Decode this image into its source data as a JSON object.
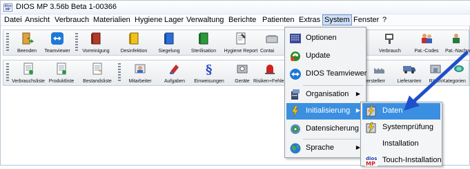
{
  "window": {
    "title": "DIOS MP 3.56b Beta 1-00366",
    "app_icon_text": "dios MP"
  },
  "menubar": {
    "items": [
      "Datei",
      "Ansicht",
      "Verbrauch",
      "Materialien",
      "Hygiene",
      "Lager",
      "Verwaltung",
      "Berichte",
      "Patienten",
      "Extras",
      "System",
      "Fenster",
      "?"
    ],
    "active": "System"
  },
  "toolbar1": {
    "buttons": [
      "Beenden",
      "Teamviewer",
      "Vorreinigung",
      "Desinfektion",
      "Siegelung",
      "Sterilisation",
      "Hygiene Report",
      "Contai",
      "Verbrauch",
      "Pat.-Codes",
      "Pat.-Nachw"
    ]
  },
  "toolbar2": {
    "buttons": [
      "Verbrauchsliste",
      "Produktliste",
      "Bestandsliste",
      "Mitarbeiter",
      "Aufgaben",
      "Einweisungen",
      "Geräte",
      "Risiken+Fehle",
      "erstellerr",
      "Lieferanten",
      "Räum",
      "Kategorien"
    ]
  },
  "system_menu": {
    "items": [
      {
        "label": "Optionen",
        "icon": "options-icon",
        "submenu": false
      },
      {
        "label": "Update",
        "icon": "update-icon",
        "submenu": false
      },
      {
        "label": "DIOS Teamviewer",
        "icon": "teamviewer-icon",
        "submenu": false
      },
      {
        "label": "Organisation",
        "icon": "organisation-icon",
        "submenu": true
      },
      {
        "label": "Initialisierung",
        "icon": "initialisierung-icon",
        "submenu": true
      },
      {
        "label": "Datensicherung",
        "icon": "backup-icon",
        "submenu": false
      },
      {
        "label": "Sprache",
        "icon": "globe-icon",
        "submenu": true
      }
    ],
    "highlighted": "Initialisierung"
  },
  "init_submenu": {
    "items": [
      {
        "label": "Daten",
        "icon": "data-icon"
      },
      {
        "label": "Systemprüfung",
        "icon": "system-check-icon"
      },
      {
        "label": "Installation",
        "icon": ""
      },
      {
        "label": "Touch-Installation",
        "icon": "dios-mp-icon"
      }
    ],
    "highlighted": "Daten",
    "dios_icon_text": "dios MP"
  },
  "colors": {
    "highlight": "#3b8fe0",
    "annotation_arrow": "#1f4fc9"
  }
}
